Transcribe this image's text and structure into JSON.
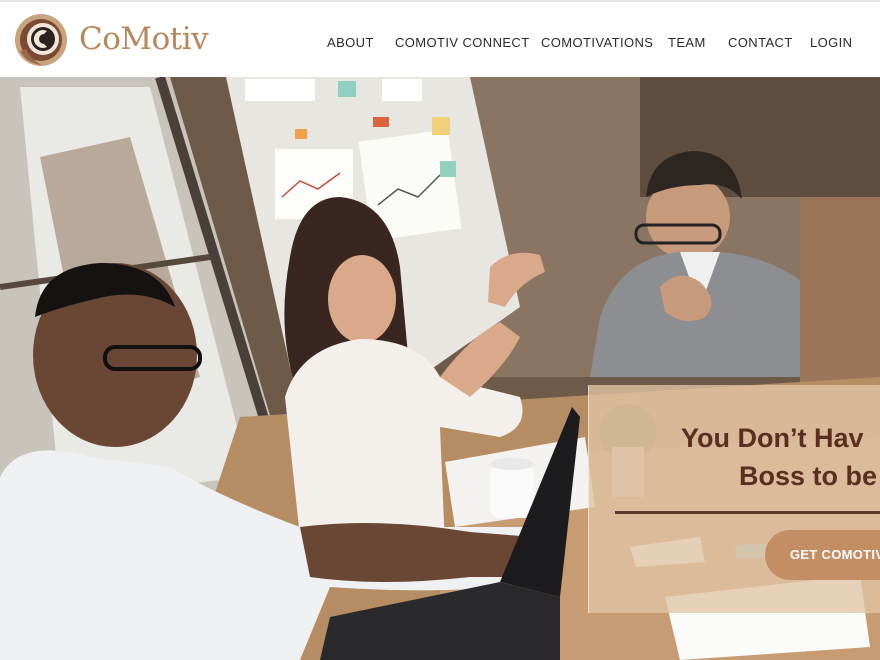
{
  "brand": {
    "name": "CoMotiv"
  },
  "nav": {
    "items": [
      "ABOUT",
      "COMOTIV CONNECT",
      "COMOTIVATIONS",
      "TEAM",
      "CONTACT",
      "LOGIN"
    ]
  },
  "hero": {
    "headline_line1": "You Don’t Hav",
    "headline_line2": "Boss to be",
    "cta_label": "GET COMOTIV"
  },
  "colors": {
    "brand_text": "#b8875a",
    "headline": "#5a2e22",
    "cta_button": "#c48e64",
    "panel_overlay": "#e2c4a5"
  }
}
